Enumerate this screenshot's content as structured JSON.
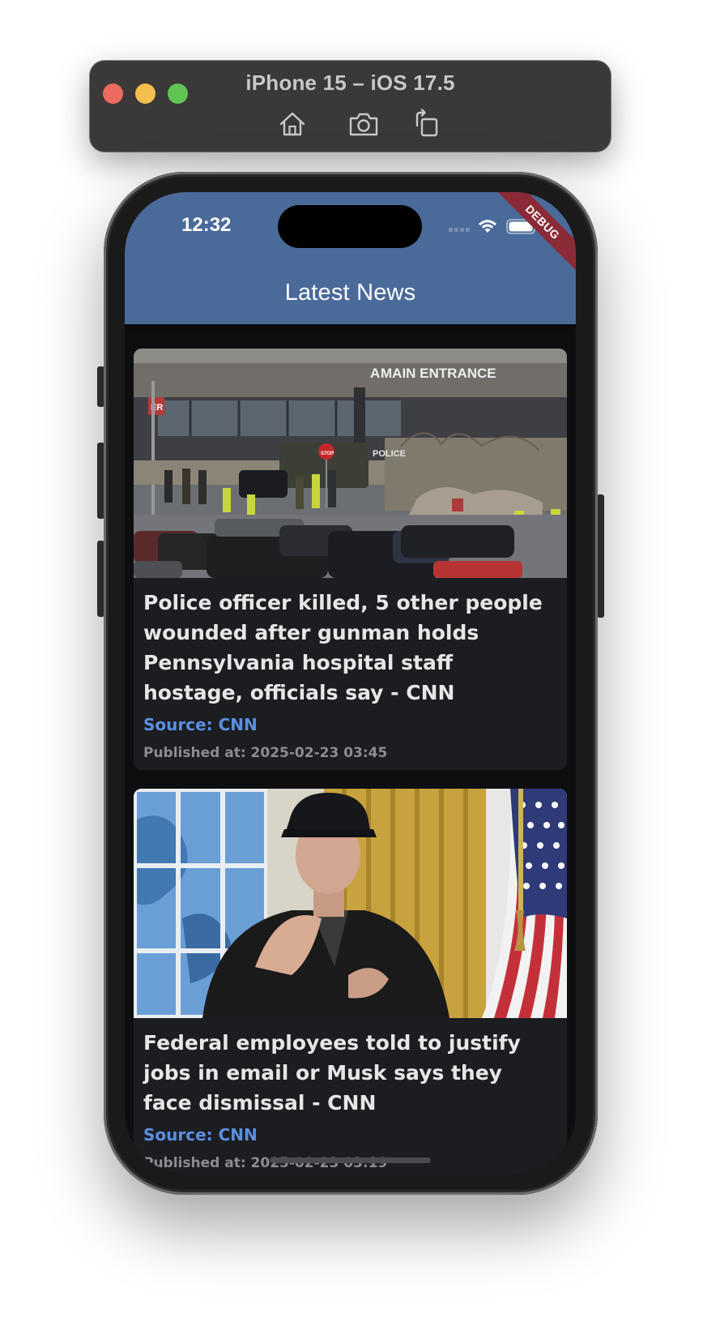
{
  "simulator": {
    "title": "iPhone 15 – iOS 17.5",
    "toolbar": [
      {
        "icon": "home-icon",
        "action": "Home"
      },
      {
        "icon": "camera-icon",
        "action": "Screenshot"
      },
      {
        "icon": "rotate-icon",
        "action": "Rotate"
      }
    ]
  },
  "status_bar": {
    "time": "12:32",
    "icons": [
      "signal-icon",
      "wifi-icon",
      "battery-icon"
    ]
  },
  "debug_banner": "DEBUG",
  "app_bar": {
    "title": "Latest News",
    "color": "#4a6a9a"
  },
  "articles": [
    {
      "title": "Police officer killed, 5 other people wounded after gunman holds Pennsylvania hospital staff hostage, officials say - CNN",
      "source": "Source: CNN",
      "published": "Published at: 2025-02-23 03:45",
      "image": "hospital-police-scene-photo",
      "image_signs": {
        "entrance": "MAIN ENTRANCE",
        "er": "ER",
        "stop": "STOP",
        "vehicle": "POLICE"
      }
    },
    {
      "title": "Federal employees told to justify jobs in email or Musk says they face dismissal - CNN",
      "source": "Source: CNN",
      "published": "Published at: 2025-02-23 03:19",
      "image": "musk-oval-office-photo"
    }
  ],
  "colors": {
    "background": "#0e0e10",
    "card": "#1c1d21",
    "source_link": "#5b8fe0",
    "title_text": "#e6e6e8",
    "debug_ribbon": "#8a2a36"
  }
}
